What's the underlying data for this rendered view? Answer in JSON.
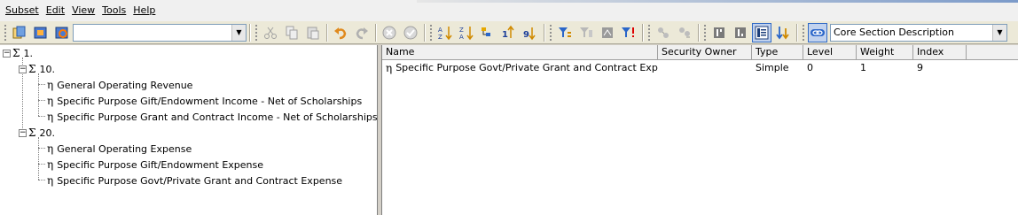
{
  "menu": {
    "items": [
      {
        "label": "Subset",
        "key": "S"
      },
      {
        "label": "Edit",
        "key": "E"
      },
      {
        "label": "View",
        "key": "V"
      },
      {
        "label": "Tools",
        "key": "T"
      },
      {
        "label": "Help",
        "key": "H"
      }
    ]
  },
  "toolbar": {
    "subset_combo_value": "",
    "attribute_combo_value": "Core Section Description",
    "icons": [
      "subset-copy-icon",
      "open-subset-icon",
      "refresh-subset-icon",
      "cut-icon",
      "copy-icon",
      "paste-icon",
      "undo-icon",
      "redo-icon",
      "delete-icon",
      "accept-icon",
      "sort-ascending-icon",
      "sort-descending-icon",
      "sort-hierarchy-icon",
      "sort-index-ascending-icon",
      "sort-index-descending-icon",
      "filter-level-icon",
      "filter-attribute-icon",
      "filter-by-expression-icon",
      "filter-icon",
      "expand-icon",
      "collapse-icon",
      "drill-up-icon",
      "drill-down-icon",
      "properties-icon",
      "show-next-icon",
      "link-icon"
    ]
  },
  "tree": {
    "nodes": [
      {
        "label": "1.",
        "kind": "consolidated",
        "expanded": true,
        "depth": 0
      },
      {
        "label": "10.",
        "kind": "consolidated",
        "expanded": true,
        "depth": 1
      },
      {
        "label": "General Operating Revenue",
        "kind": "leaf",
        "depth": 2
      },
      {
        "label": "Specific Purpose Gift/Endowment Income - Net of Scholarships",
        "kind": "leaf",
        "depth": 2
      },
      {
        "label": "Specific Purpose Grant and Contract Income - Net of Scholarships",
        "kind": "leaf",
        "depth": 2
      },
      {
        "label": "20.",
        "kind": "consolidated",
        "expanded": true,
        "depth": 1
      },
      {
        "label": "General Operating Expense",
        "kind": "leaf",
        "depth": 2
      },
      {
        "label": "Specific Purpose Gift/Endowment Expense",
        "kind": "leaf",
        "depth": 2
      },
      {
        "label": "Specific Purpose Govt/Private Grant and Contract Expense",
        "kind": "leaf",
        "depth": 2
      }
    ]
  },
  "grid": {
    "columns": [
      "Name",
      "Security Owner",
      "Type",
      "Level",
      "Weight",
      "Index"
    ],
    "rows": [
      {
        "name": "Specific Purpose Govt/Private Grant and Contract Expense",
        "security_owner": "",
        "type": "Simple",
        "level": "0",
        "weight": "1",
        "index": "9"
      }
    ]
  },
  "glyphs": {
    "sigma": "Σ",
    "leaf": "η",
    "minus": "−",
    "dropdown": "▼"
  }
}
